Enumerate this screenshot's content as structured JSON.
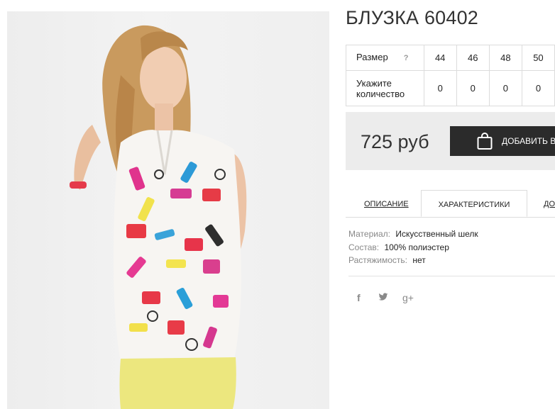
{
  "product": {
    "title": "БЛУЗКА 60402",
    "image_alt": "Женщина в блузке с принтом косметики и желтых брюках"
  },
  "size_table": {
    "size_label": "Размер",
    "help_icon": "?",
    "sizes": [
      "44",
      "46",
      "48",
      "50"
    ],
    "qty_label_line1": "Укажите",
    "qty_label_line2": "количество",
    "quantities": [
      "0",
      "0",
      "0",
      "0"
    ]
  },
  "buy": {
    "price": "725 руб",
    "add_label": "ДОБАВИТЬ В",
    "icon": "shopping-bag-icon"
  },
  "tabs": [
    {
      "label": "ОПИСАНИЕ",
      "active": false
    },
    {
      "label": "ХАРАКТЕРИСТИКИ",
      "active": true
    },
    {
      "label": "ДО",
      "active": false
    }
  ],
  "specs": [
    {
      "key": "Материал:",
      "value": "Искусственный шелк"
    },
    {
      "key": "Состав:",
      "value": "100% полиэстер"
    },
    {
      "key": "Растяжимость:",
      "value": "нет"
    }
  ],
  "social": [
    {
      "icon": "facebook-icon",
      "glyph": "f"
    },
    {
      "icon": "twitter-icon",
      "glyph": "🐦"
    },
    {
      "icon": "google-plus-icon",
      "glyph": "g+"
    }
  ],
  "colors": {
    "button_bg": "#2b2b2b",
    "buybox_bg": "#ececec",
    "border": "#dcdcdc"
  }
}
